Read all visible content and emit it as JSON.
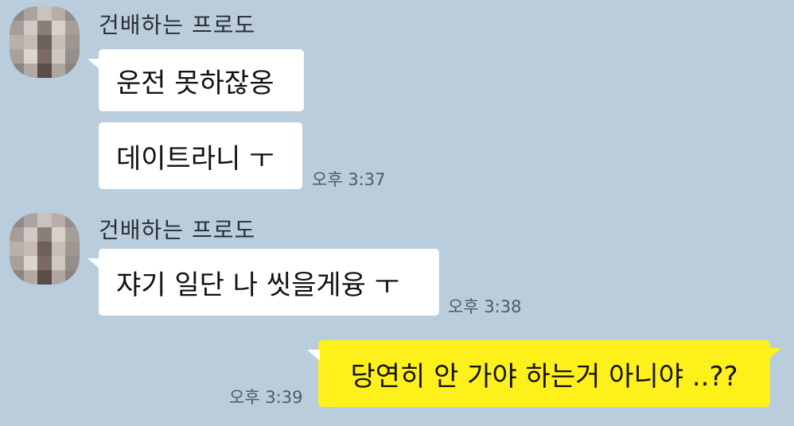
{
  "messages": [
    {
      "sender": "건배하는 프로도",
      "bubbles": [
        "운전 못하잖옹",
        "데이트라니 ㅜ"
      ],
      "time": "오후 3:37"
    },
    {
      "sender": "건배하는 프로도",
      "bubbles": [
        "쟈기 일단 나 씻을게융 ㅜ"
      ],
      "time": "오후 3:38"
    },
    {
      "mine": true,
      "bubbles": [
        "당연히 안 가야 하는거 아니야 ..??"
      ],
      "time": "오후 3:39"
    }
  ],
  "colors": {
    "background": "#b9cddc",
    "incoming_bubble": "#ffffff",
    "outgoing_bubble": "#fef01b"
  }
}
